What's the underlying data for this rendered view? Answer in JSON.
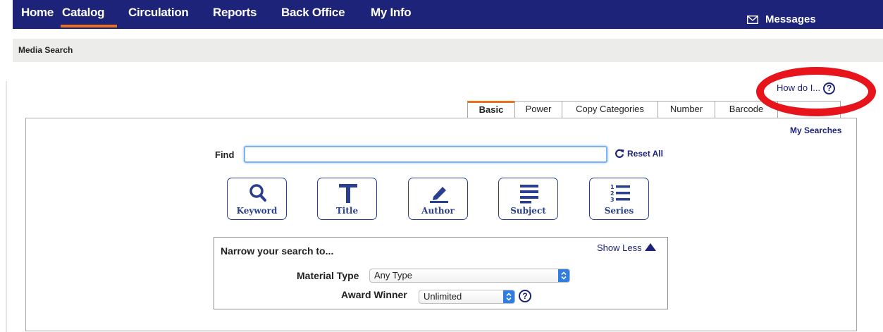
{
  "nav": {
    "items": [
      "Home",
      "Catalog",
      "Circulation",
      "Reports",
      "Back Office",
      "My Info"
    ],
    "active": "Catalog",
    "messages_label": "Messages"
  },
  "breadcrumb": {
    "title": "Media Search"
  },
  "help": {
    "how_do_i": "How do I...",
    "help_glyph": "?"
  },
  "tabs": {
    "items": [
      "Basic",
      "Power",
      "Copy Categories",
      "Number",
      "Barcode"
    ],
    "active": "Basic"
  },
  "search": {
    "my_searches": "My Searches",
    "find_label": "Find",
    "find_value": "",
    "reset_all": "Reset All",
    "buttons": [
      "Keyword",
      "Title",
      "Author",
      "Subject",
      "Series"
    ]
  },
  "narrow": {
    "title": "Narrow your search to...",
    "toggle": "Show Less",
    "material_type_label": "Material Type",
    "material_type_value": "Any Type",
    "award_winner_label": "Award Winner",
    "award_winner_value": "Unlimited"
  },
  "colors": {
    "nav_bg": "#1c2378",
    "accent": "#e9701f",
    "link": "#1c2378",
    "highlight_ring": "#e8141b",
    "select_arrow": "#2f7de1"
  }
}
